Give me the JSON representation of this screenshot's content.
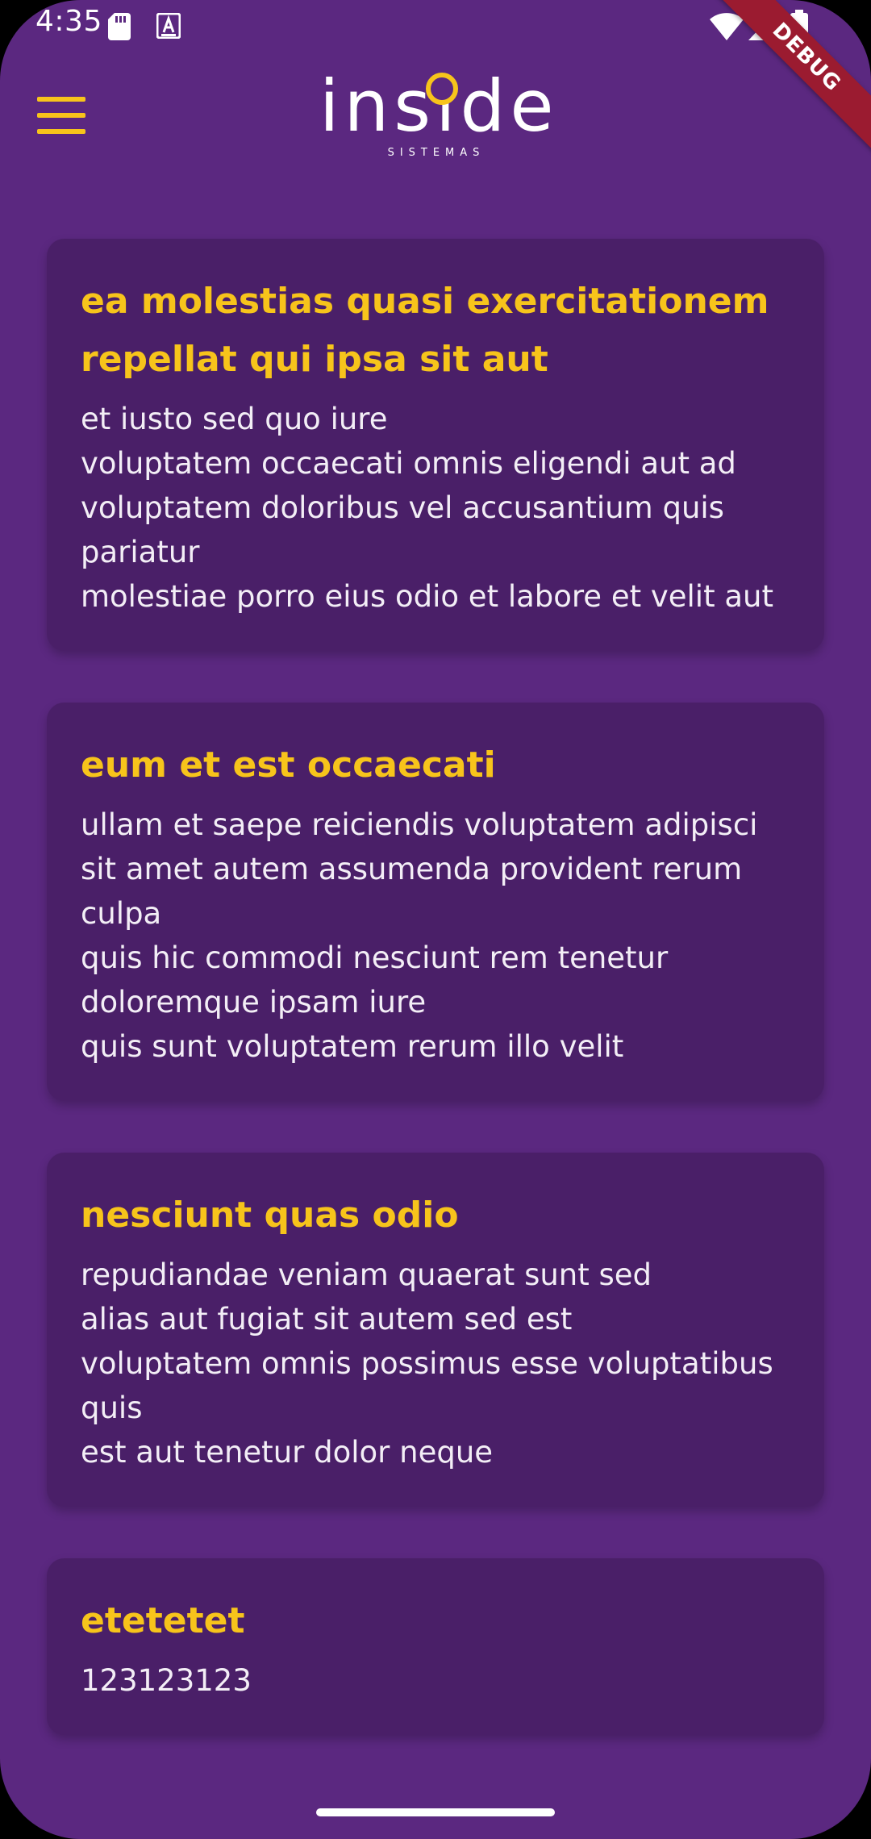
{
  "status_bar": {
    "time": "4:35",
    "debug_label": "DEBUG"
  },
  "header": {
    "logo_text": "inside",
    "logo_subtitle": "SISTEMAS"
  },
  "posts": [
    {
      "title": "ea molestias quasi exercitationem repellat qui ipsa sit aut",
      "body": "et iusto sed quo iure\nvoluptatem occaecati omnis eligendi aut ad\nvoluptatem doloribus vel accusantium quis pariatur\nmolestiae porro eius odio et labore et velit aut"
    },
    {
      "title": "eum et est occaecati",
      "body": "ullam et saepe reiciendis voluptatem adipisci\nsit amet autem assumenda provident rerum culpa\nquis hic commodi nesciunt rem tenetur doloremque ipsam iure\nquis sunt voluptatem rerum illo velit"
    },
    {
      "title": "nesciunt quas odio",
      "body": "repudiandae veniam quaerat sunt sed\nalias aut fugiat sit autem sed est\nvoluptatem omnis possimus esse voluptatibus quis\nest aut tenetur dolor neque"
    },
    {
      "title": "etetetet",
      "body": "123123123"
    }
  ],
  "colors": {
    "background": "#5b2880",
    "card": "#4a1f68",
    "accent": "#f7c41b",
    "text": "#f3eef6"
  },
  "icons": {
    "menu": "menu-icon",
    "sd_card": "sd-card-icon",
    "notification": "a-notification-icon",
    "wifi": "wifi-icon",
    "signal": "signal-icon",
    "battery": "battery-icon"
  }
}
